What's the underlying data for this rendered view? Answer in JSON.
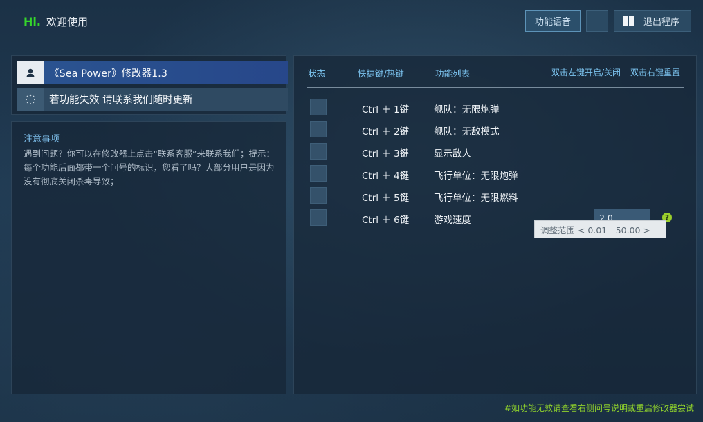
{
  "header": {
    "brand_hi": "Hi.",
    "brand_text": "欢迎使用",
    "voice_button": "功能语音",
    "exit_button": "退出程序"
  },
  "info": {
    "title": "《Sea Power》修改器1.3",
    "notice": "若功能失效 请联系我们随时更新"
  },
  "notes": {
    "title": "注意事项",
    "body": "遇到问题？你可以在修改器上点击“联系客服”来联系我们；提示：每个功能后面都带一个问号的标识，您看了吗？大部分用户是因为没有彻底关闭杀毒导致；"
  },
  "table": {
    "headers": {
      "state": "状态",
      "hotkey": "快捷键/热键",
      "features": "功能列表",
      "hint_left": "双击左键开启/关闭",
      "hint_right": "双击右键重置"
    },
    "rows": [
      {
        "key": "Ctrl ＋ 1键",
        "feature": "舰队：无限炮弹"
      },
      {
        "key": "Ctrl ＋ 2键",
        "feature": "舰队：无敌模式"
      },
      {
        "key": "Ctrl ＋ 3键",
        "feature": "显示敌人"
      },
      {
        "key": "Ctrl ＋ 4键",
        "feature": "飞行单位：无限炮弹"
      },
      {
        "key": "Ctrl ＋ 5键",
        "feature": "飞行单位：无限燃料"
      },
      {
        "key": "Ctrl ＋ 6键",
        "feature": "游戏速度"
      }
    ],
    "speed_value": "2.0",
    "help_glyph": "?",
    "tooltip": "调整范围 < 0.01 - 50.00 >"
  },
  "footer": {
    "text": "#如功能无效请查看右侧问号说明或重启修改器尝试"
  },
  "icons": [
    "user-icon",
    "loading-icon",
    "minimize-icon",
    "windows-icon",
    "help-icon"
  ],
  "colors": {
    "brand_green": "#35d62b",
    "accent_blue": "#7cc4f0",
    "title_bar_blue": "#2a5390",
    "help_green": "#9bcf2c",
    "footer_green": "#8fd12c"
  }
}
